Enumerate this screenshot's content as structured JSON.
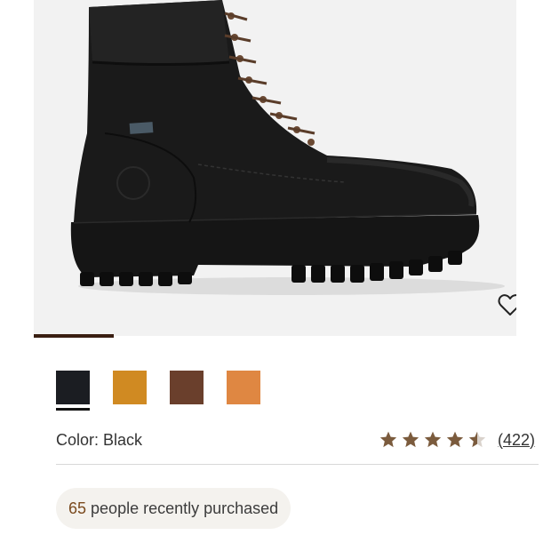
{
  "product": {
    "image_alt": "Black leather work boot",
    "wishlist_icon": "heart-outline-icon",
    "gallery_progress": 0.166
  },
  "swatches": [
    {
      "name": "Black",
      "color": "#1b1d22",
      "selected": true
    },
    {
      "name": "Wheat",
      "color": "#d08a22",
      "selected": false
    },
    {
      "name": "Brown",
      "color": "#6a3f2c",
      "selected": false
    },
    {
      "name": "Rust",
      "color": "#df8742",
      "selected": false
    }
  ],
  "color_label": "Color: Black",
  "rating": {
    "value": 4.5,
    "max": 5,
    "review_count": "(422)",
    "star_color": "#7b5b3d"
  },
  "social_proof": {
    "count": "65",
    "text": "people recently purchased"
  }
}
